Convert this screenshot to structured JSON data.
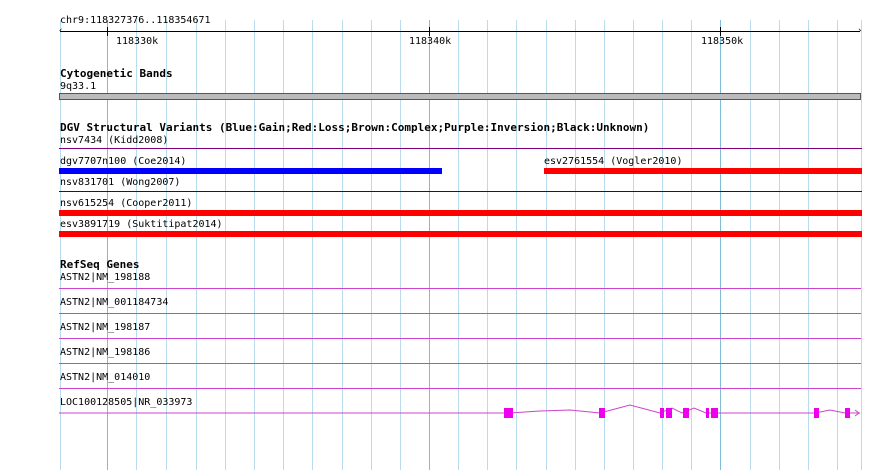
{
  "ruler": {
    "range_label": "chr9:118327376..118354671",
    "ticks": [
      "118330k",
      "118340k",
      "118350k"
    ]
  },
  "cytoband": {
    "title": "Cytogenetic Bands",
    "band_label": "9q33.1",
    "band_color": "#bbbbbb"
  },
  "dgv": {
    "title": "DGV Structural Variants (Blue:Gain;Red:Loss;Brown:Complex;Purple:Inversion;Black:Unknown)",
    "colors": {
      "gain": "#0000ff",
      "loss": "#ff0000",
      "inversion": "#800080"
    },
    "variants": [
      {
        "label": "nsv7434 (Kidd2008)",
        "type": "inversion"
      },
      {
        "label": "dgv7707n100 (Coe2014)",
        "type": "gain"
      },
      {
        "label": "esv2761554 (Vogler2010)",
        "type": "loss"
      },
      {
        "label": "nsv831701 (Wong2007)",
        "type": "gain"
      },
      {
        "label": "nsv615254 (Cooper2011)",
        "type": "loss"
      },
      {
        "label": "esv3891719 (Suktitipat2014)",
        "type": "loss"
      }
    ]
  },
  "refseq": {
    "title": "RefSeq Genes",
    "gene_color": "#ee00ee",
    "genes": [
      {
        "label": "ASTN2|NM_198188"
      },
      {
        "label": "ASTN2|NM_001184734"
      },
      {
        "label": "ASTN2|NM_198187"
      },
      {
        "label": "ASTN2|NM_198186"
      },
      {
        "label": "ASTN2|NM_014010"
      },
      {
        "label": "LOC100128505|NR_033973"
      }
    ]
  }
}
